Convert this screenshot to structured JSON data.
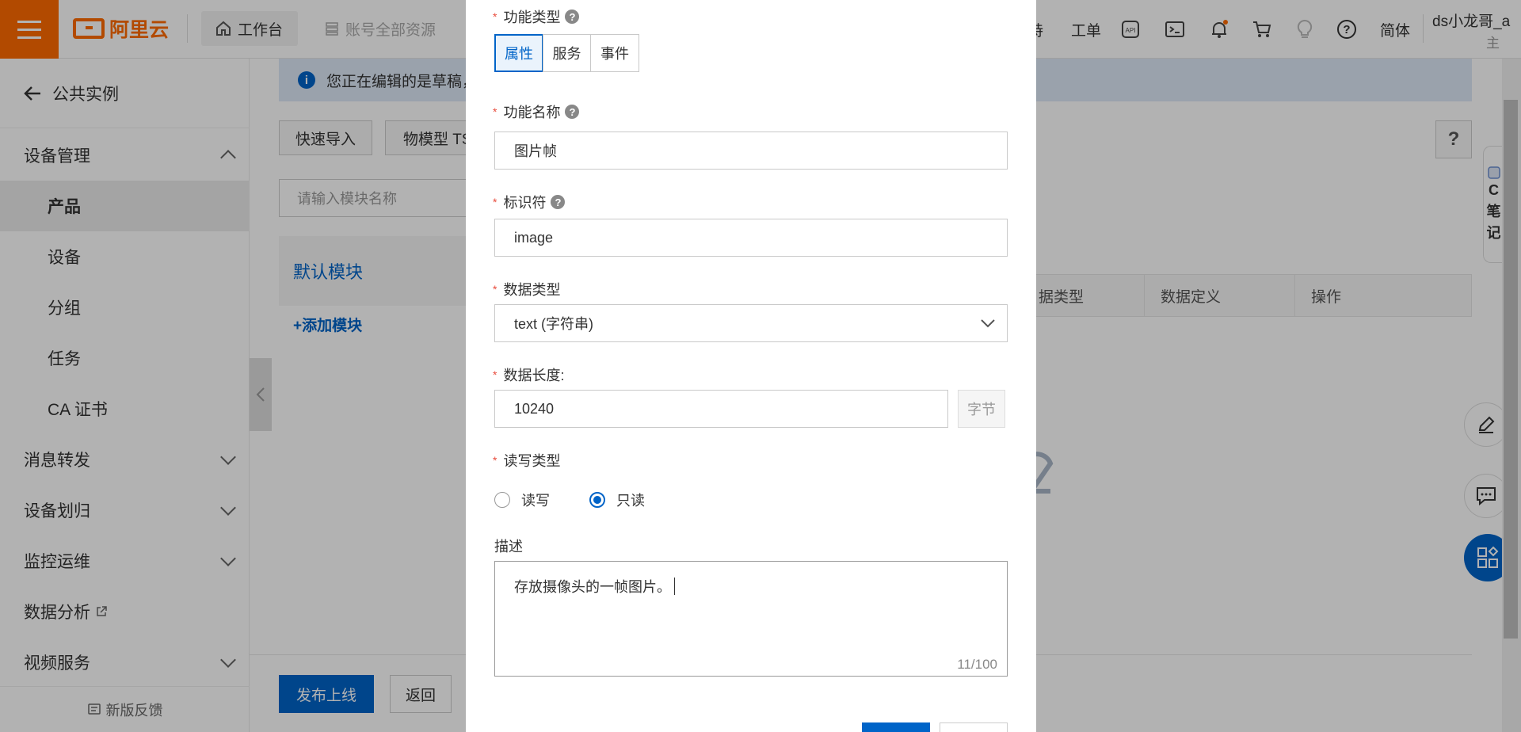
{
  "topbar": {
    "brand": "阿里云",
    "workbench": "工作台",
    "account_resources": "账号全部资源",
    "right_partial": "持",
    "ticket": "工单",
    "lang": "简体",
    "user_partial": "ds小龙哥_a",
    "user_sub_partial": "主"
  },
  "sidebar": {
    "back_label": "公共实例",
    "device_mgmt": "设备管理",
    "items": [
      "产品",
      "设备",
      "分组",
      "任务",
      "CA 证书"
    ],
    "message_forward": "消息转发",
    "device_assign": "设备划归",
    "monitor_ops": "监控运维",
    "data_analysis": "数据分析",
    "video_service": "视频服务",
    "feedback": "新版反馈"
  },
  "main": {
    "info_text": "您正在编辑的是草稿，",
    "quick_import": "快速导入",
    "tsl_partial": "物模型 TS",
    "module_search_placeholder": "请输入模块名称",
    "default_module": "默认模块",
    "add_module": "+添加模块",
    "table_headers": [
      "据类型",
      "数据定义",
      "操作"
    ],
    "publish": "发布上线",
    "back": "返回",
    "help": "?",
    "float_note_chars": [
      "C",
      "笔",
      "记"
    ]
  },
  "modal": {
    "func_type_label": "功能类型",
    "func_types": [
      "属性",
      "服务",
      "事件"
    ],
    "func_type_selected": "属性",
    "func_name_label": "功能名称",
    "func_name_value": "图片帧",
    "identifier_label": "标识符",
    "identifier_value": "image",
    "data_type_label": "数据类型",
    "data_type_value": "text (字符串)",
    "data_length_label": "数据长度:",
    "data_length_value": "10240",
    "data_length_unit": "字节",
    "rw_type_label": "读写类型",
    "rw_options": [
      "读写",
      "只读"
    ],
    "rw_selected": "只读",
    "desc_label": "描述",
    "desc_value": "存放摄像头的一帧图片。",
    "desc_counter": "11/100"
  },
  "colors": {
    "brand_orange": "#ff6a00",
    "primary_blue": "#0064c8",
    "required_red": "#e84c3d"
  }
}
